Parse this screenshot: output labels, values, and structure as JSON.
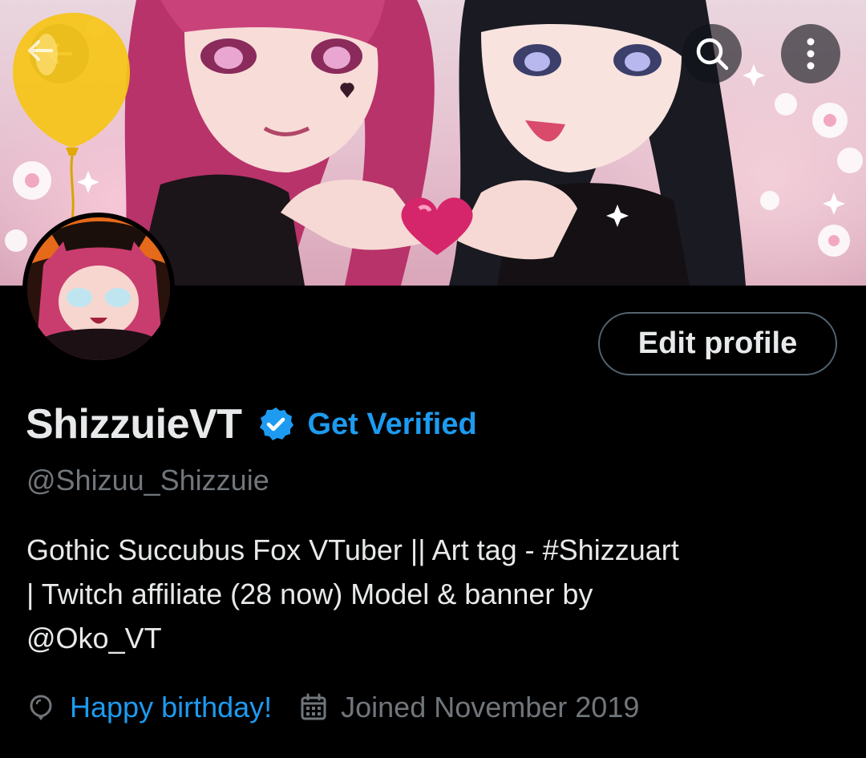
{
  "header": {
    "back_icon": "arrow-left-icon",
    "search_icon": "search-icon",
    "more_icon": "more-vertical-icon"
  },
  "profile": {
    "display_name": "ShizzuieVT",
    "verified_badge_icon": "verified-badge-icon",
    "get_verified_label": "Get Verified",
    "handle": "@Shizuu_Shizzuie",
    "edit_profile_label": "Edit profile",
    "bio_lines": [
      "Gothic Succubus Fox VTuber || Art tag - #Shizzuart",
      "| Twitch affiliate (28 now) Model & banner by",
      "@Oko_VT"
    ],
    "birthday_label": "Happy birthday!",
    "joined_label": "Joined November 2019"
  },
  "colors": {
    "background": "#000000",
    "accent": "#1d9bf0",
    "secondary_text": "#71767b",
    "primary_text": "#e7e9ea",
    "balloon": "#f5c518"
  }
}
